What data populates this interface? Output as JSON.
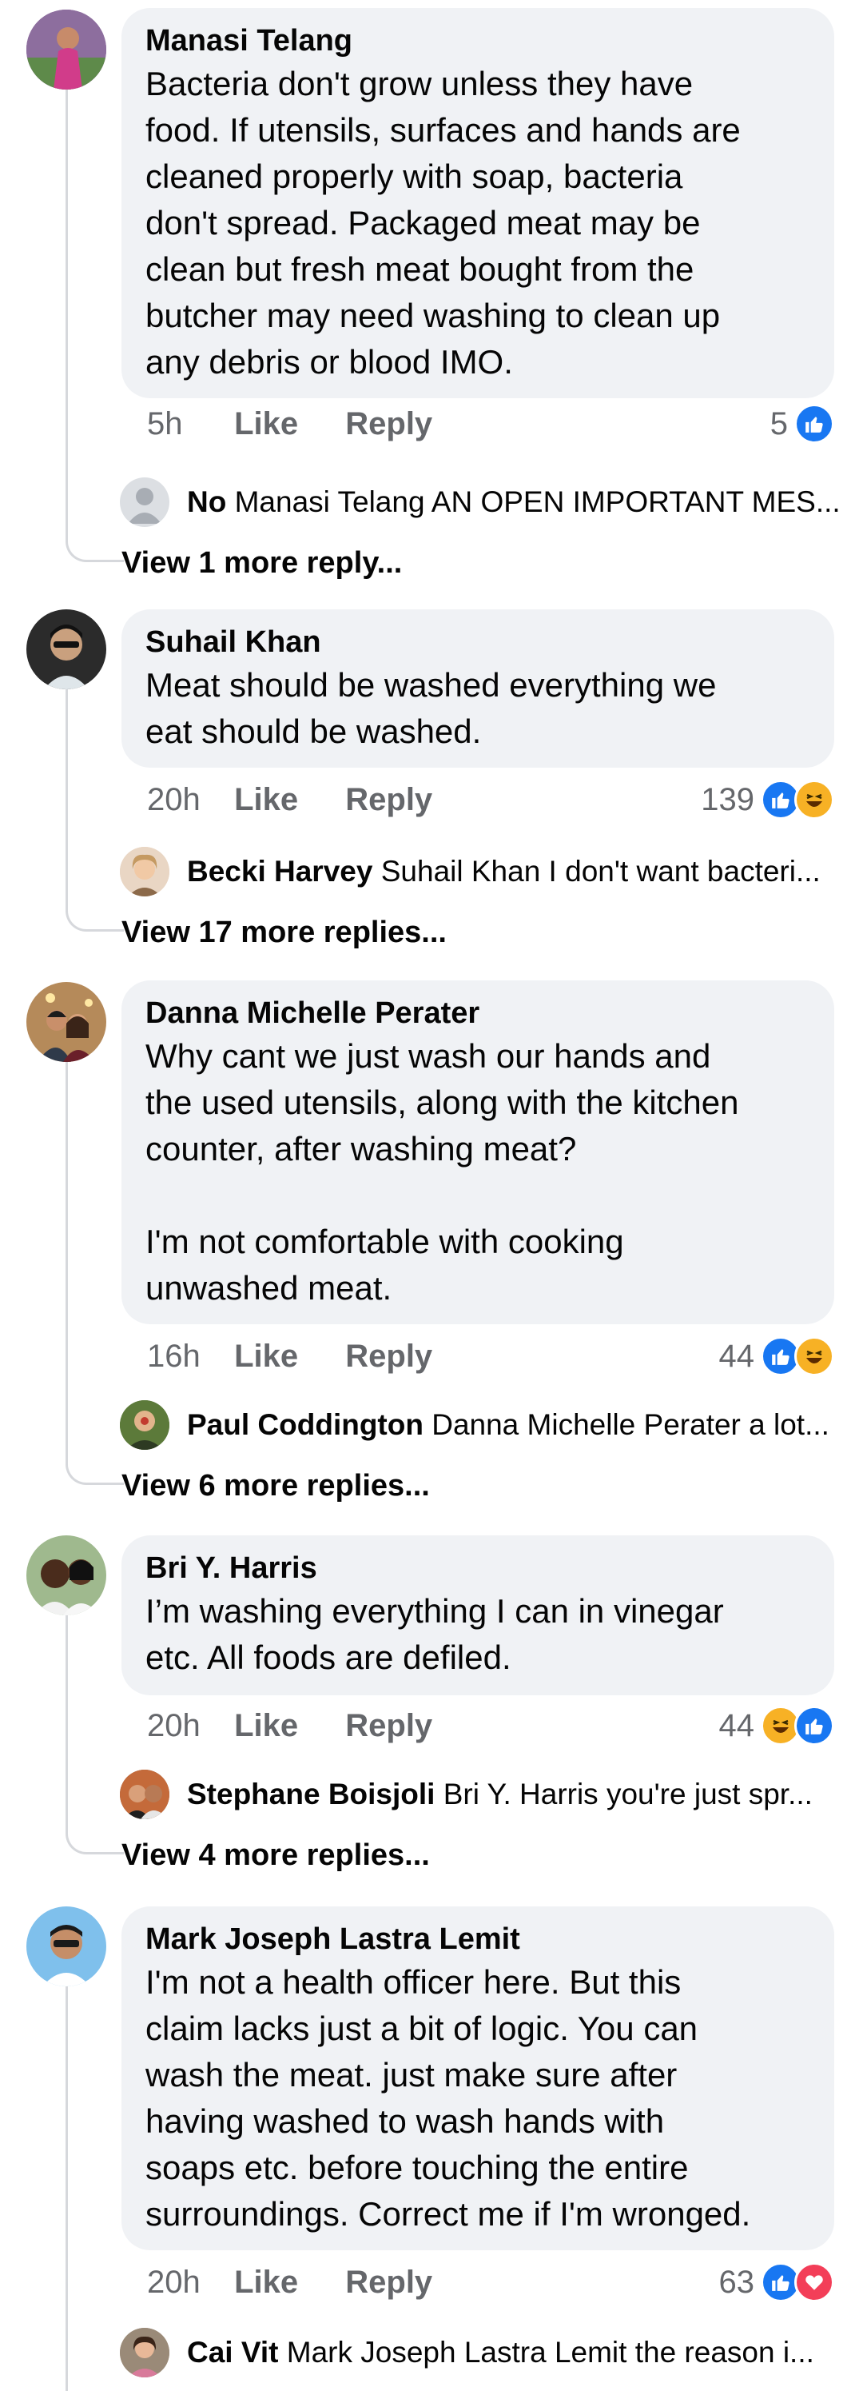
{
  "comments": [
    {
      "author": "Manasi Telang",
      "text": "Bacteria don't grow unless they have\nfood. If utensils, surfaces and hands are\ncleaned properly with soap, bacteria\ndon't spread. Packaged meat may be\nclean but fresh meat bought from the\nbutcher may need washing to clean up\nany debris or blood IMO.",
      "time": "5h",
      "like": "Like",
      "reply": "Reply",
      "reaction_count": "5",
      "reactions": [
        "like"
      ],
      "reply_preview": {
        "author": "No",
        "text": " Manasi Telang AN OPEN IMPORTANT MES..."
      },
      "more_replies": "View 1 more reply..."
    },
    {
      "author": "Suhail Khan",
      "text": "Meat should be washed everything we\neat should be washed.",
      "time": "20h",
      "like": "Like",
      "reply": "Reply",
      "reaction_count": "139",
      "reactions": [
        "like",
        "haha"
      ],
      "reply_preview": {
        "author": "Becki Harvey",
        "text": " Suhail Khan I don't want bacteri..."
      },
      "more_replies": "View 17 more replies..."
    },
    {
      "author": "Danna Michelle Perater",
      "text": "Why cant we just wash our hands and\nthe used utensils, along with the kitchen\ncounter, after washing meat?\n\nI'm not comfortable with cooking\nunwashed meat.",
      "time": "16h",
      "like": "Like",
      "reply": "Reply",
      "reaction_count": "44",
      "reactions": [
        "like",
        "haha"
      ],
      "reply_preview": {
        "author": "Paul Coddington",
        "text": " Danna Michelle Perater a lot..."
      },
      "more_replies": "View 6 more replies..."
    },
    {
      "author": "Bri Y. Harris",
      "text": "I’m washing everything I can in vinegar\netc. All foods are defiled.",
      "time": "20h",
      "like": "Like",
      "reply": "Reply",
      "reaction_count": "44",
      "reactions": [
        "haha",
        "like"
      ],
      "reply_preview": {
        "author": "Stephane Boisjoli",
        "text": " Bri Y. Harris you're just spr..."
      },
      "more_replies": "View 4 more replies..."
    },
    {
      "author": "Mark Joseph Lastra Lemit",
      "text": "I'm not a health officer here. But this\nclaim lacks just a bit of logic. You can\nwash the meat. just make sure after\nhaving washed to wash hands with\nsoaps etc. before touching the entire\nsurroundings. Correct me if I'm wronged.",
      "time": "20h",
      "like": "Like",
      "reply": "Reply",
      "reaction_count": "63",
      "reactions": [
        "like",
        "love"
      ],
      "reply_preview": {
        "author": "Cai Vit",
        "text": " Mark Joseph Lastra Lemit the reason i..."
      },
      "more_replies": ""
    }
  ],
  "colors": {
    "like": "#1877f2",
    "love": "#f33e58",
    "haha": "#f7b125",
    "bubble": "#f0f2f5",
    "meta": "#65676b"
  }
}
